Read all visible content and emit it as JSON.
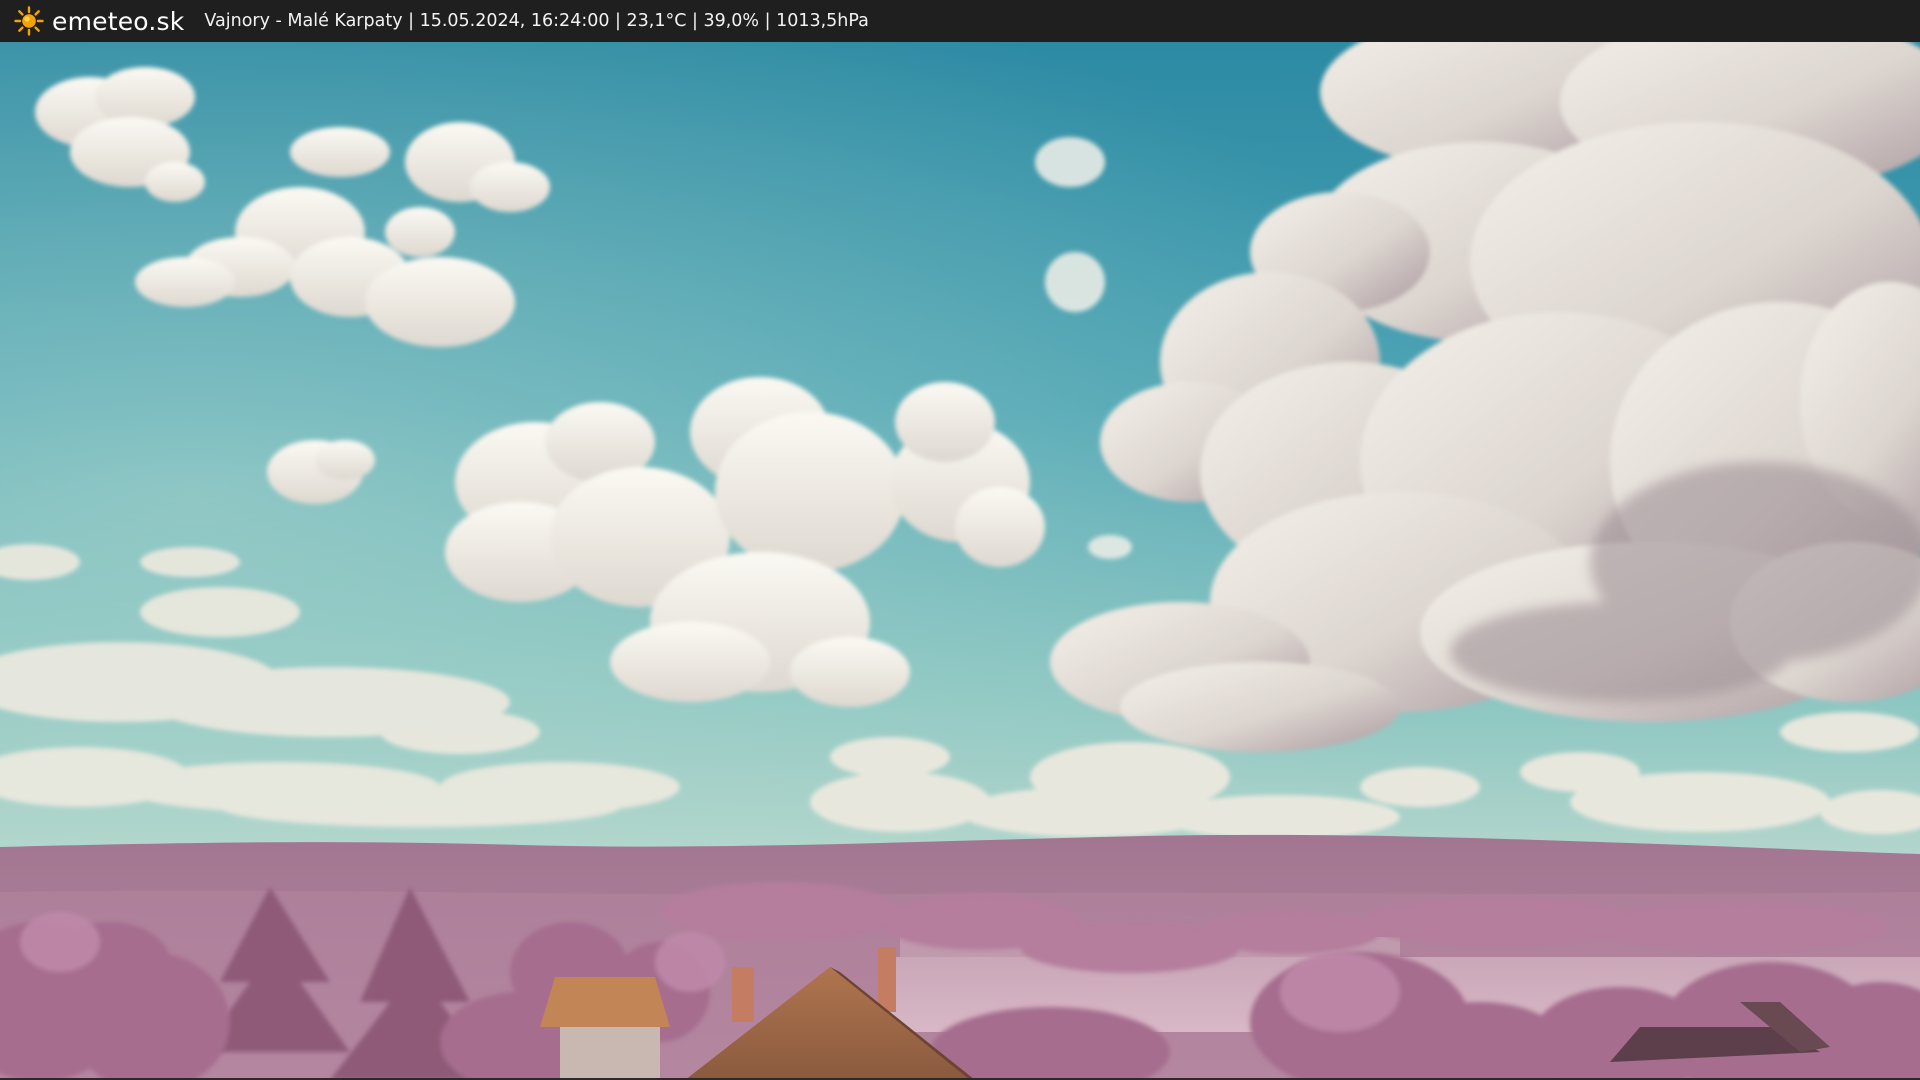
{
  "header": {
    "brand": "emeteo.sk",
    "logo_icon": "sun-icon",
    "caption": "Vajnory - Malé Karpaty | 15.05.2024, 16:24:00 | 23,1°C | 39,0% | 1013,5hPa"
  },
  "colors": {
    "topbar": "#1f1f1f",
    "sun": "#f5a300",
    "sky_top": "#2f8ea6",
    "sky_bottom": "#8fc7c3",
    "foliage": "#b07896",
    "hills": "#a47892"
  }
}
